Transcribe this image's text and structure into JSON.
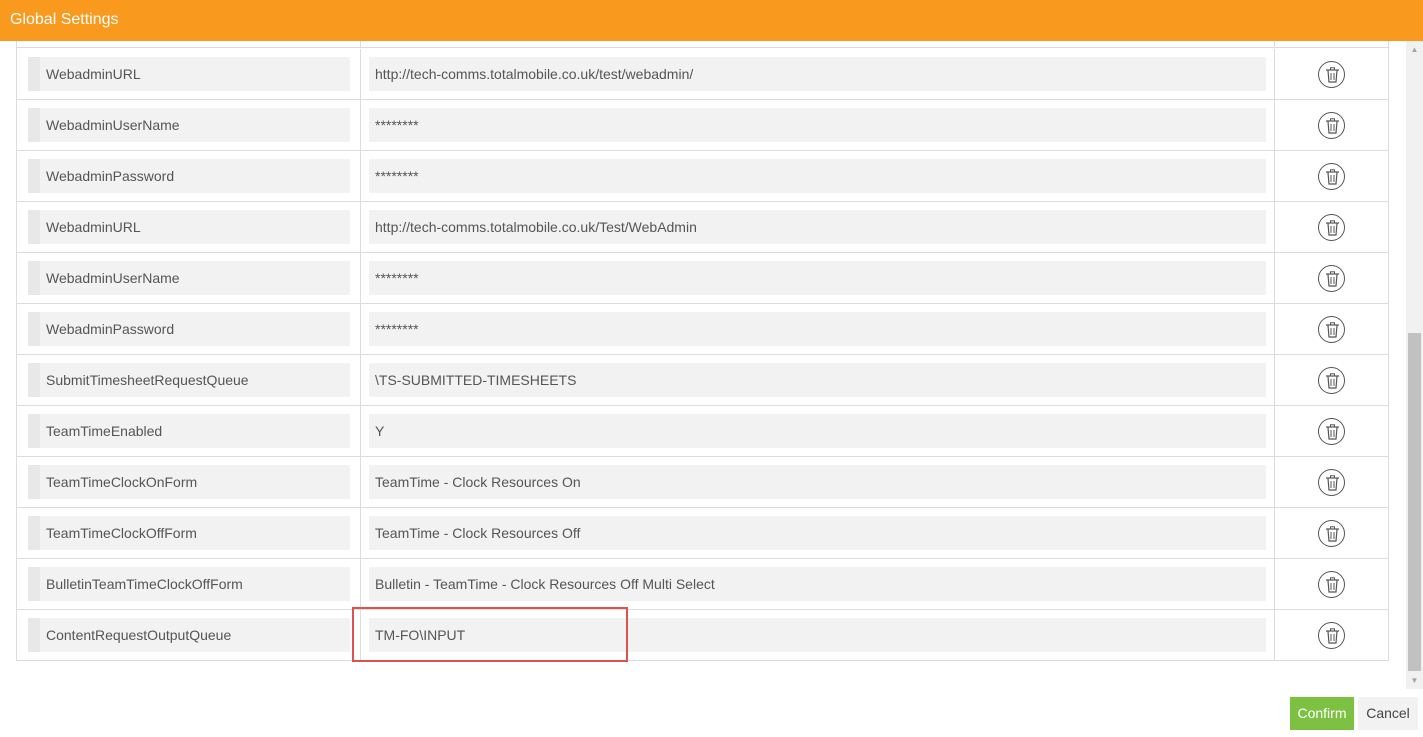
{
  "window": {
    "title": "Global Settings"
  },
  "settings": [
    {
      "name": "WebadminURL",
      "value": "http://tech-comms.totalmobile.co.uk/test/webadmin/"
    },
    {
      "name": "WebadminUserName",
      "value": "********"
    },
    {
      "name": "WebadminPassword",
      "value": "********"
    },
    {
      "name": "WebadminURL",
      "value": "http://tech-comms.totalmobile.co.uk/Test/WebAdmin"
    },
    {
      "name": "WebadminUserName",
      "value": "********"
    },
    {
      "name": "WebadminPassword",
      "value": "********"
    },
    {
      "name": "SubmitTimesheetRequestQueue",
      "value": "\\TS-SUBMITTED-TIMESHEETS"
    },
    {
      "name": "TeamTimeEnabled",
      "value": "Y"
    },
    {
      "name": "TeamTimeClockOnForm",
      "value": "TeamTime - Clock Resources On"
    },
    {
      "name": "TeamTimeClockOffForm",
      "value": "TeamTime - Clock Resources Off"
    },
    {
      "name": "BulletinTeamTimeClockOffForm",
      "value": "Bulletin - TeamTime - Clock Resources Off Multi Select"
    },
    {
      "name": "ContentRequestOutputQueue",
      "value": "TM-FO\\INPUT"
    }
  ],
  "icons": {
    "delete": "trash-icon",
    "scroll_up": "triangle-up-icon",
    "scroll_down": "triangle-down-icon"
  },
  "footer": {
    "confirm_label": "Confirm",
    "cancel_label": "Cancel"
  },
  "colors": {
    "titlebar": "#f99a1e",
    "confirm": "#7dc142",
    "highlight": "#d9534f"
  }
}
